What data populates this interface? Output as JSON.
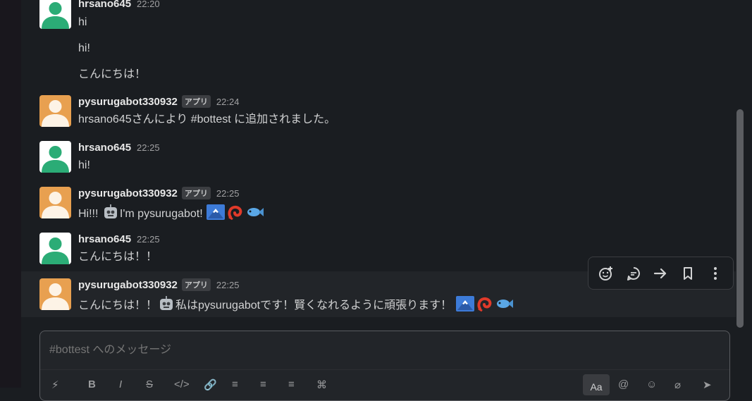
{
  "colors": {
    "user_avatar": "#2bac76",
    "bot_avatar": "#e8a050"
  },
  "messages": [
    {
      "name": "hrsano645",
      "time": "22:20",
      "lines": [
        "hi",
        "hi!",
        "こんにちは！"
      ]
    },
    {
      "name": "pysurugabot330932",
      "badge": "アプリ",
      "time": "22:24",
      "text": "hrsano645さんにより #bottest に追加されました。"
    },
    {
      "name": "hrsano645",
      "time": "22:25",
      "text": "hi!"
    },
    {
      "name": "pysurugabot330932",
      "badge": "アプリ",
      "time": "22:25",
      "text_a": "Hi!!! ",
      "text_b": "I'm pysurugabot! "
    },
    {
      "name": "hrsano645",
      "time": "22:25",
      "text": "こんにちは！！"
    },
    {
      "name": "pysurugabot330932",
      "badge": "アプリ",
      "time": "22:25",
      "text_a": "こんにちは！！",
      "text_b": "私はpysurugabotです！賢くなれるように頑張ります！ "
    }
  ],
  "hover_toolbar": {
    "icons": [
      "add-reaction-icon",
      "reply-thread-icon",
      "forward-icon",
      "bookmark-icon",
      "more-icon"
    ]
  },
  "composer": {
    "placeholder": "#bottest へのメッセージ",
    "format_buttons": [
      "B",
      "I",
      "S",
      "</>",
      "link",
      "ol",
      "ul",
      "quote",
      "code"
    ],
    "aa_label": "Aa"
  }
}
